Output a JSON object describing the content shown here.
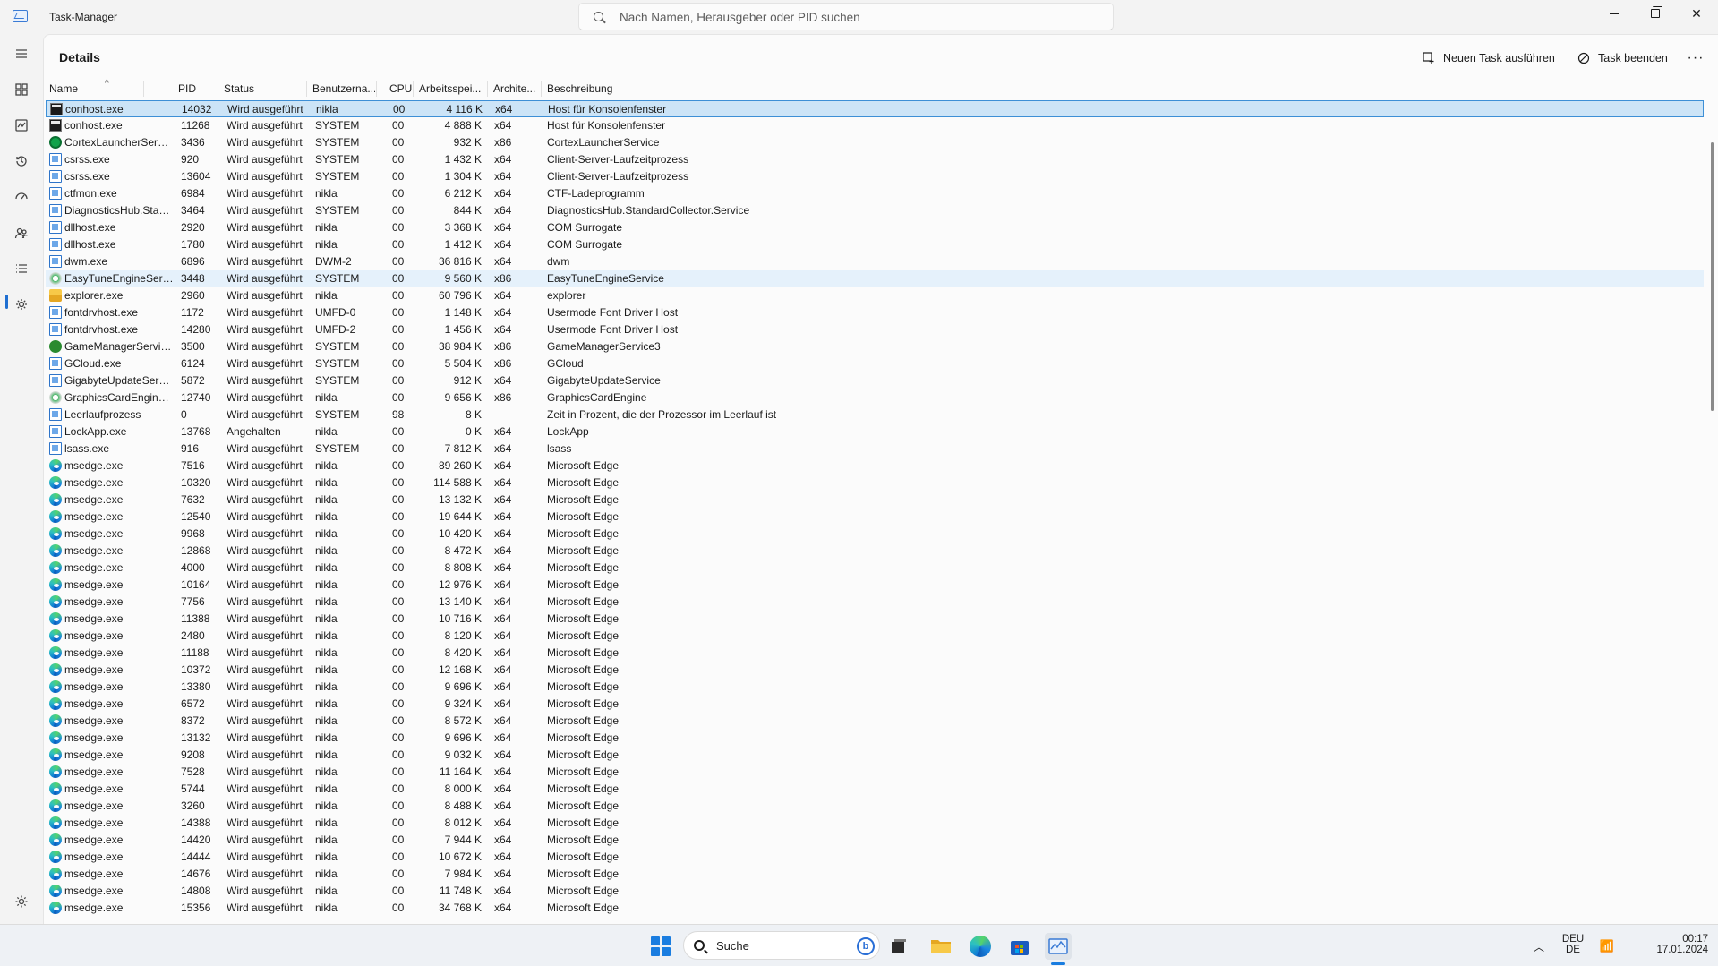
{
  "window": {
    "title": "Task-Manager",
    "search_placeholder": "Nach Namen, Herausgeber oder PID suchen"
  },
  "header": {
    "page_title": "Details",
    "run_task_label": "Neuen Task ausführen",
    "end_task_label": "Task beenden",
    "more_label": "···"
  },
  "columns": {
    "name": "Name",
    "pid": "PID",
    "status": "Status",
    "user": "Benutzerna...",
    "cpu": "CPU",
    "memory": "Arbeitsspei...",
    "arch": "Archite...",
    "description": "Beschreibung"
  },
  "rows": [
    {
      "icon": "console-icon",
      "name": "conhost.exe",
      "pid": "14032",
      "status": "Wird ausgeführt",
      "user": "nikla",
      "cpu": "00",
      "mem": "4 116 K",
      "arch": "x64",
      "desc": "Host für Konsolenfenster"
    },
    {
      "icon": "console-icon",
      "name": "conhost.exe",
      "pid": "11268",
      "status": "Wird ausgeführt",
      "user": "SYSTEM",
      "cpu": "00",
      "mem": "4 888 K",
      "arch": "x64",
      "desc": "Host für Konsolenfenster"
    },
    {
      "icon": "green-circle-icon",
      "name": "CortexLauncherServi...",
      "pid": "3436",
      "status": "Wird ausgeführt",
      "user": "SYSTEM",
      "cpu": "00",
      "mem": "932 K",
      "arch": "x86",
      "desc": "CortexLauncherService"
    },
    {
      "icon": "app-window-icon",
      "name": "csrss.exe",
      "pid": "920",
      "status": "Wird ausgeführt",
      "user": "SYSTEM",
      "cpu": "00",
      "mem": "1 432 K",
      "arch": "x64",
      "desc": "Client-Server-Laufzeitprozess"
    },
    {
      "icon": "app-window-icon",
      "name": "csrss.exe",
      "pid": "13604",
      "status": "Wird ausgeführt",
      "user": "SYSTEM",
      "cpu": "00",
      "mem": "1 304 K",
      "arch": "x64",
      "desc": "Client-Server-Laufzeitprozess"
    },
    {
      "icon": "app-window-icon",
      "name": "ctfmon.exe",
      "pid": "6984",
      "status": "Wird ausgeführt",
      "user": "nikla",
      "cpu": "00",
      "mem": "6 212 K",
      "arch": "x64",
      "desc": "CTF-Ladeprogramm"
    },
    {
      "icon": "app-window-icon",
      "name": "DiagnosticsHub.Stan...",
      "pid": "3464",
      "status": "Wird ausgeführt",
      "user": "SYSTEM",
      "cpu": "00",
      "mem": "844 K",
      "arch": "x64",
      "desc": "DiagnosticsHub.StandardCollector.Service"
    },
    {
      "icon": "app-window-icon",
      "name": "dllhost.exe",
      "pid": "2920",
      "status": "Wird ausgeführt",
      "user": "nikla",
      "cpu": "00",
      "mem": "3 368 K",
      "arch": "x64",
      "desc": "COM Surrogate"
    },
    {
      "icon": "app-window-icon",
      "name": "dllhost.exe",
      "pid": "1780",
      "status": "Wird ausgeführt",
      "user": "nikla",
      "cpu": "00",
      "mem": "1 412 K",
      "arch": "x64",
      "desc": "COM Surrogate"
    },
    {
      "icon": "app-window-icon",
      "name": "dwm.exe",
      "pid": "6896",
      "status": "Wird ausgeführt",
      "user": "DWM-2",
      "cpu": "00",
      "mem": "36 816 K",
      "arch": "x64",
      "desc": "dwm"
    },
    {
      "icon": "easytune-icon",
      "name": "EasyTuneEngineServi...",
      "pid": "3448",
      "status": "Wird ausgeführt",
      "user": "SYSTEM",
      "cpu": "00",
      "mem": "9 560 K",
      "arch": "x86",
      "desc": "EasyTuneEngineService"
    },
    {
      "icon": "folder-icon",
      "name": "explorer.exe",
      "pid": "2960",
      "status": "Wird ausgeführt",
      "user": "nikla",
      "cpu": "00",
      "mem": "60 796 K",
      "arch": "x64",
      "desc": "explorer"
    },
    {
      "icon": "app-window-icon",
      "name": "fontdrvhost.exe",
      "pid": "1172",
      "status": "Wird ausgeführt",
      "user": "UMFD-0",
      "cpu": "00",
      "mem": "1 148 K",
      "arch": "x64",
      "desc": "Usermode Font Driver Host"
    },
    {
      "icon": "app-window-icon",
      "name": "fontdrvhost.exe",
      "pid": "14280",
      "status": "Wird ausgeführt",
      "user": "UMFD-2",
      "cpu": "00",
      "mem": "1 456 K",
      "arch": "x64",
      "desc": "Usermode Font Driver Host"
    },
    {
      "icon": "game-manager-icon",
      "name": "GameManagerServic...",
      "pid": "3500",
      "status": "Wird ausgeführt",
      "user": "SYSTEM",
      "cpu": "00",
      "mem": "38 984 K",
      "arch": "x86",
      "desc": "GameManagerService3"
    },
    {
      "icon": "app-window-icon",
      "name": "GCloud.exe",
      "pid": "6124",
      "status": "Wird ausgeführt",
      "user": "SYSTEM",
      "cpu": "00",
      "mem": "5 504 K",
      "arch": "x86",
      "desc": "GCloud"
    },
    {
      "icon": "app-window-icon",
      "name": "GigabyteUpdateServi...",
      "pid": "5872",
      "status": "Wird ausgeführt",
      "user": "SYSTEM",
      "cpu": "00",
      "mem": "912 K",
      "arch": "x64",
      "desc": "GigabyteUpdateService"
    },
    {
      "icon": "easytune-icon",
      "name": "GraphicsCardEngine....",
      "pid": "12740",
      "status": "Wird ausgeführt",
      "user": "nikla",
      "cpu": "00",
      "mem": "9 656 K",
      "arch": "x86",
      "desc": "GraphicsCardEngine"
    },
    {
      "icon": "app-window-icon",
      "name": "Leerlaufprozess",
      "pid": "0",
      "status": "Wird ausgeführt",
      "user": "SYSTEM",
      "cpu": "98",
      "mem": "8 K",
      "arch": "",
      "desc": "Zeit in Prozent, die der Prozessor im Leerlauf ist"
    },
    {
      "icon": "app-window-icon",
      "name": "LockApp.exe",
      "pid": "13768",
      "status": "Angehalten",
      "user": "nikla",
      "cpu": "00",
      "mem": "0 K",
      "arch": "x64",
      "desc": "LockApp"
    },
    {
      "icon": "app-window-icon",
      "name": "lsass.exe",
      "pid": "916",
      "status": "Wird ausgeführt",
      "user": "SYSTEM",
      "cpu": "00",
      "mem": "7 812 K",
      "arch": "x64",
      "desc": "lsass"
    },
    {
      "icon": "edge-icon",
      "name": "msedge.exe",
      "pid": "7516",
      "status": "Wird ausgeführt",
      "user": "nikla",
      "cpu": "00",
      "mem": "89 260 K",
      "arch": "x64",
      "desc": "Microsoft Edge"
    },
    {
      "icon": "edge-icon",
      "name": "msedge.exe",
      "pid": "10320",
      "status": "Wird ausgeführt",
      "user": "nikla",
      "cpu": "00",
      "mem": "114 588 K",
      "arch": "x64",
      "desc": "Microsoft Edge"
    },
    {
      "icon": "edge-icon",
      "name": "msedge.exe",
      "pid": "7632",
      "status": "Wird ausgeführt",
      "user": "nikla",
      "cpu": "00",
      "mem": "13 132 K",
      "arch": "x64",
      "desc": "Microsoft Edge"
    },
    {
      "icon": "edge-icon",
      "name": "msedge.exe",
      "pid": "12540",
      "status": "Wird ausgeführt",
      "user": "nikla",
      "cpu": "00",
      "mem": "19 644 K",
      "arch": "x64",
      "desc": "Microsoft Edge"
    },
    {
      "icon": "edge-icon",
      "name": "msedge.exe",
      "pid": "9968",
      "status": "Wird ausgeführt",
      "user": "nikla",
      "cpu": "00",
      "mem": "10 420 K",
      "arch": "x64",
      "desc": "Microsoft Edge"
    },
    {
      "icon": "edge-icon",
      "name": "msedge.exe",
      "pid": "12868",
      "status": "Wird ausgeführt",
      "user": "nikla",
      "cpu": "00",
      "mem": "8 472 K",
      "arch": "x64",
      "desc": "Microsoft Edge"
    },
    {
      "icon": "edge-icon",
      "name": "msedge.exe",
      "pid": "4000",
      "status": "Wird ausgeführt",
      "user": "nikla",
      "cpu": "00",
      "mem": "8 808 K",
      "arch": "x64",
      "desc": "Microsoft Edge"
    },
    {
      "icon": "edge-icon",
      "name": "msedge.exe",
      "pid": "10164",
      "status": "Wird ausgeführt",
      "user": "nikla",
      "cpu": "00",
      "mem": "12 976 K",
      "arch": "x64",
      "desc": "Microsoft Edge"
    },
    {
      "icon": "edge-icon",
      "name": "msedge.exe",
      "pid": "7756",
      "status": "Wird ausgeführt",
      "user": "nikla",
      "cpu": "00",
      "mem": "13 140 K",
      "arch": "x64",
      "desc": "Microsoft Edge"
    },
    {
      "icon": "edge-icon",
      "name": "msedge.exe",
      "pid": "11388",
      "status": "Wird ausgeführt",
      "user": "nikla",
      "cpu": "00",
      "mem": "10 716 K",
      "arch": "x64",
      "desc": "Microsoft Edge"
    },
    {
      "icon": "edge-icon",
      "name": "msedge.exe",
      "pid": "2480",
      "status": "Wird ausgeführt",
      "user": "nikla",
      "cpu": "00",
      "mem": "8 120 K",
      "arch": "x64",
      "desc": "Microsoft Edge"
    },
    {
      "icon": "edge-icon",
      "name": "msedge.exe",
      "pid": "11188",
      "status": "Wird ausgeführt",
      "user": "nikla",
      "cpu": "00",
      "mem": "8 420 K",
      "arch": "x64",
      "desc": "Microsoft Edge"
    },
    {
      "icon": "edge-icon",
      "name": "msedge.exe",
      "pid": "10372",
      "status": "Wird ausgeführt",
      "user": "nikla",
      "cpu": "00",
      "mem": "12 168 K",
      "arch": "x64",
      "desc": "Microsoft Edge"
    },
    {
      "icon": "edge-icon",
      "name": "msedge.exe",
      "pid": "13380",
      "status": "Wird ausgeführt",
      "user": "nikla",
      "cpu": "00",
      "mem": "9 696 K",
      "arch": "x64",
      "desc": "Microsoft Edge"
    },
    {
      "icon": "edge-icon",
      "name": "msedge.exe",
      "pid": "6572",
      "status": "Wird ausgeführt",
      "user": "nikla",
      "cpu": "00",
      "mem": "9 324 K",
      "arch": "x64",
      "desc": "Microsoft Edge"
    },
    {
      "icon": "edge-icon",
      "name": "msedge.exe",
      "pid": "8372",
      "status": "Wird ausgeführt",
      "user": "nikla",
      "cpu": "00",
      "mem": "8 572 K",
      "arch": "x64",
      "desc": "Microsoft Edge"
    },
    {
      "icon": "edge-icon",
      "name": "msedge.exe",
      "pid": "13132",
      "status": "Wird ausgeführt",
      "user": "nikla",
      "cpu": "00",
      "mem": "9 696 K",
      "arch": "x64",
      "desc": "Microsoft Edge"
    },
    {
      "icon": "edge-icon",
      "name": "msedge.exe",
      "pid": "9208",
      "status": "Wird ausgeführt",
      "user": "nikla",
      "cpu": "00",
      "mem": "9 032 K",
      "arch": "x64",
      "desc": "Microsoft Edge"
    },
    {
      "icon": "edge-icon",
      "name": "msedge.exe",
      "pid": "7528",
      "status": "Wird ausgeführt",
      "user": "nikla",
      "cpu": "00",
      "mem": "11 164 K",
      "arch": "x64",
      "desc": "Microsoft Edge"
    },
    {
      "icon": "edge-icon",
      "name": "msedge.exe",
      "pid": "5744",
      "status": "Wird ausgeführt",
      "user": "nikla",
      "cpu": "00",
      "mem": "8 000 K",
      "arch": "x64",
      "desc": "Microsoft Edge"
    },
    {
      "icon": "edge-icon",
      "name": "msedge.exe",
      "pid": "3260",
      "status": "Wird ausgeführt",
      "user": "nikla",
      "cpu": "00",
      "mem": "8 488 K",
      "arch": "x64",
      "desc": "Microsoft Edge"
    },
    {
      "icon": "edge-icon",
      "name": "msedge.exe",
      "pid": "14388",
      "status": "Wird ausgeführt",
      "user": "nikla",
      "cpu": "00",
      "mem": "8 012 K",
      "arch": "x64",
      "desc": "Microsoft Edge"
    },
    {
      "icon": "edge-icon",
      "name": "msedge.exe",
      "pid": "14420",
      "status": "Wird ausgeführt",
      "user": "nikla",
      "cpu": "00",
      "mem": "7 944 K",
      "arch": "x64",
      "desc": "Microsoft Edge"
    },
    {
      "icon": "edge-icon",
      "name": "msedge.exe",
      "pid": "14444",
      "status": "Wird ausgeführt",
      "user": "nikla",
      "cpu": "00",
      "mem": "10 672 K",
      "arch": "x64",
      "desc": "Microsoft Edge"
    },
    {
      "icon": "edge-icon",
      "name": "msedge.exe",
      "pid": "14676",
      "status": "Wird ausgeführt",
      "user": "nikla",
      "cpu": "00",
      "mem": "7 984 K",
      "arch": "x64",
      "desc": "Microsoft Edge"
    },
    {
      "icon": "edge-icon",
      "name": "msedge.exe",
      "pid": "14808",
      "status": "Wird ausgeführt",
      "user": "nikla",
      "cpu": "00",
      "mem": "11 748 K",
      "arch": "x64",
      "desc": "Microsoft Edge"
    },
    {
      "icon": "edge-icon",
      "name": "msedge.exe",
      "pid": "15356",
      "status": "Wird ausgeführt",
      "user": "nikla",
      "cpu": "00",
      "mem": "34 768 K",
      "arch": "x64",
      "desc": "Microsoft Edge"
    }
  ],
  "selected_row": 0,
  "hover_row": 10,
  "taskbar": {
    "search_label": "Suche",
    "lang_line1": "DEU",
    "lang_line2": "DE",
    "time": "00:17",
    "date": "17.01.2024"
  },
  "colors": {
    "accent": "#1a7de0",
    "selection": "#cce4f7"
  }
}
